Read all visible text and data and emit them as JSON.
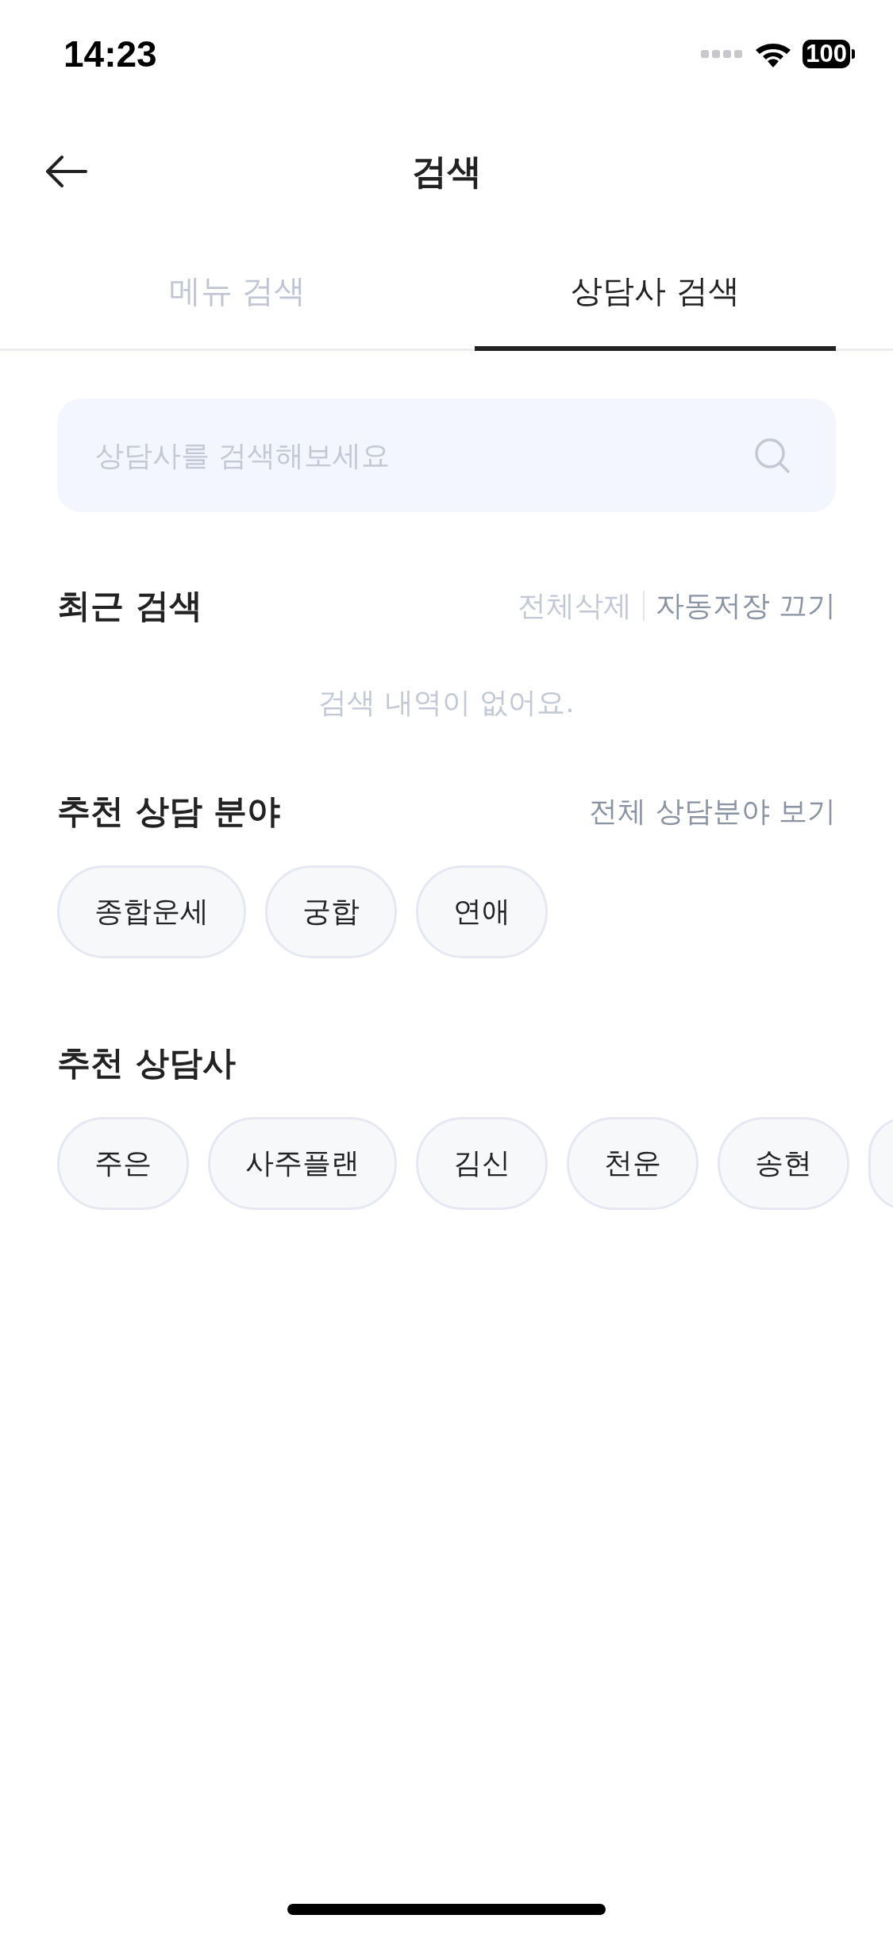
{
  "status_bar": {
    "time": "14:23",
    "battery": "100"
  },
  "header": {
    "title": "검색"
  },
  "tabs": [
    {
      "label": "메뉴 검색",
      "selected": false
    },
    {
      "label": "상담사 검색",
      "selected": true
    }
  ],
  "search": {
    "placeholder": "상담사를 검색해보세요"
  },
  "recent": {
    "title": "최근 검색",
    "actions": [
      {
        "label": "전체삭제",
        "disabled": true
      },
      {
        "label": "자동저장 끄기",
        "disabled": false
      }
    ],
    "empty_message": "검색 내역이 없어요."
  },
  "fields": {
    "title": "추천 상담 분야",
    "link": "전체 상담분야 보기",
    "chips": [
      {
        "kind": "chip",
        "label": "종합운세"
      },
      {
        "kind": "chip",
        "label": "궁합"
      },
      {
        "kind": "chip",
        "label": "연애"
      }
    ]
  },
  "counselors": {
    "title": "추천 상담사",
    "chips": [
      {
        "kind": "chip",
        "label": "주은"
      },
      {
        "kind": "chip",
        "label": "사주플랜"
      },
      {
        "kind": "chip",
        "label": "김신"
      },
      {
        "kind": "chip",
        "label": "천운"
      },
      {
        "kind": "chip",
        "label": "송현"
      },
      {
        "kind": "partial"
      }
    ]
  }
}
